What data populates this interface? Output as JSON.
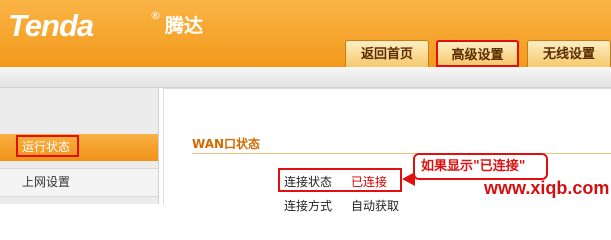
{
  "brand": {
    "logo_text": "Tenda",
    "reg_mark": "®",
    "chinese_name": "腾达"
  },
  "nav_tabs": [
    {
      "label": "返回首页"
    },
    {
      "label": "高级设置",
      "highlighted": true
    },
    {
      "label": "无线设置"
    }
  ],
  "sidebar": {
    "items": [
      {
        "label": "运行状态",
        "active": true
      },
      {
        "label": "上网设置"
      }
    ]
  },
  "main": {
    "section_title": "WAN口状态",
    "rows": [
      {
        "label": "连接状态",
        "value": "已连接"
      },
      {
        "label": "连接方式",
        "value": "自动获取"
      }
    ]
  },
  "annotation": {
    "callout_text": "如果显示\"已连接\""
  },
  "watermark": "www.xiqb.com",
  "colors": {
    "header_orange": "#f39a1c",
    "highlight_red": "#e01010",
    "status_red": "#d80000"
  }
}
